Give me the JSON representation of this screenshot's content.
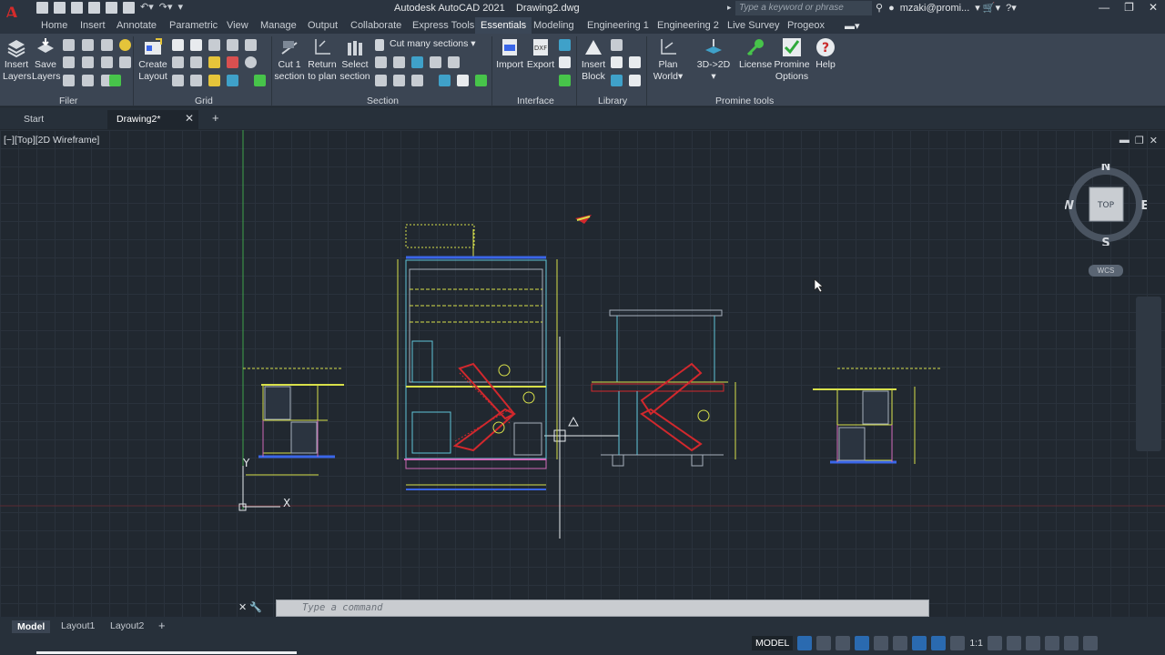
{
  "app": {
    "title": "Autodesk AutoCAD 2021",
    "file": "Drawing2.dwg",
    "search_placeholder": "Type a keyword or phrase",
    "user": "mzaki@promi..."
  },
  "menu": [
    "Home",
    "Insert",
    "Annotate",
    "Parametric",
    "View",
    "Manage",
    "Output",
    "Collaborate",
    "Express Tools",
    "Essentials",
    "Modeling",
    "Engineering 1",
    "Engineering 2",
    "Live Survey",
    "Progeox"
  ],
  "menu_active": "Essentials",
  "ribbon": {
    "filer": {
      "label": "Filer",
      "insert_layers_1": "Insert",
      "insert_layers_2": "Layers",
      "save_layers_1": "Save",
      "save_layers_2": "Layers"
    },
    "grid": {
      "label": "Grid",
      "create_layout_1": "Create",
      "create_layout_2": "Layout"
    },
    "section": {
      "label": "Section",
      "cut1_1": "Cut 1",
      "cut1_2": "section",
      "return_1": "Return",
      "return_2": "to plan",
      "select_1": "Select",
      "select_2": "section",
      "cut_many": "Cut many  sections"
    },
    "interface": {
      "label": "Interface",
      "import": "Import",
      "export": "Export",
      "dxf": "DXF"
    },
    "library": {
      "label": "Library",
      "insert_block_1": "Insert",
      "insert_block_2": "Block"
    },
    "promine": {
      "label": "Promine tools",
      "plan_world_1": "Plan",
      "plan_world_2": "World",
      "d3to2d": "3D->2D",
      "license": "License",
      "options_1": "Promine",
      "options_2": "Options",
      "help": "Help"
    }
  },
  "tabs": {
    "start": "Start",
    "drawing": "Drawing2*"
  },
  "viewport": {
    "label": "[−][Top][2D Wireframe]"
  },
  "viewcube": {
    "n": "N",
    "s": "S",
    "e": "E",
    "w": "W",
    "face": "TOP",
    "wcs": "WCS"
  },
  "ucs": {
    "x": "X",
    "y": "Y"
  },
  "command": {
    "placeholder": "Type a command"
  },
  "layouts": [
    "Model",
    "Layout1",
    "Layout2"
  ],
  "status": {
    "model": "MODEL",
    "scale": "1:1"
  },
  "colors": {
    "drawing_yellow": "#d8e04a",
    "drawing_red": "#d2282d",
    "drawing_cyan": "#5fc4d8",
    "drawing_blue": "#3a66e8",
    "drawing_magenta": "#d068b8"
  }
}
